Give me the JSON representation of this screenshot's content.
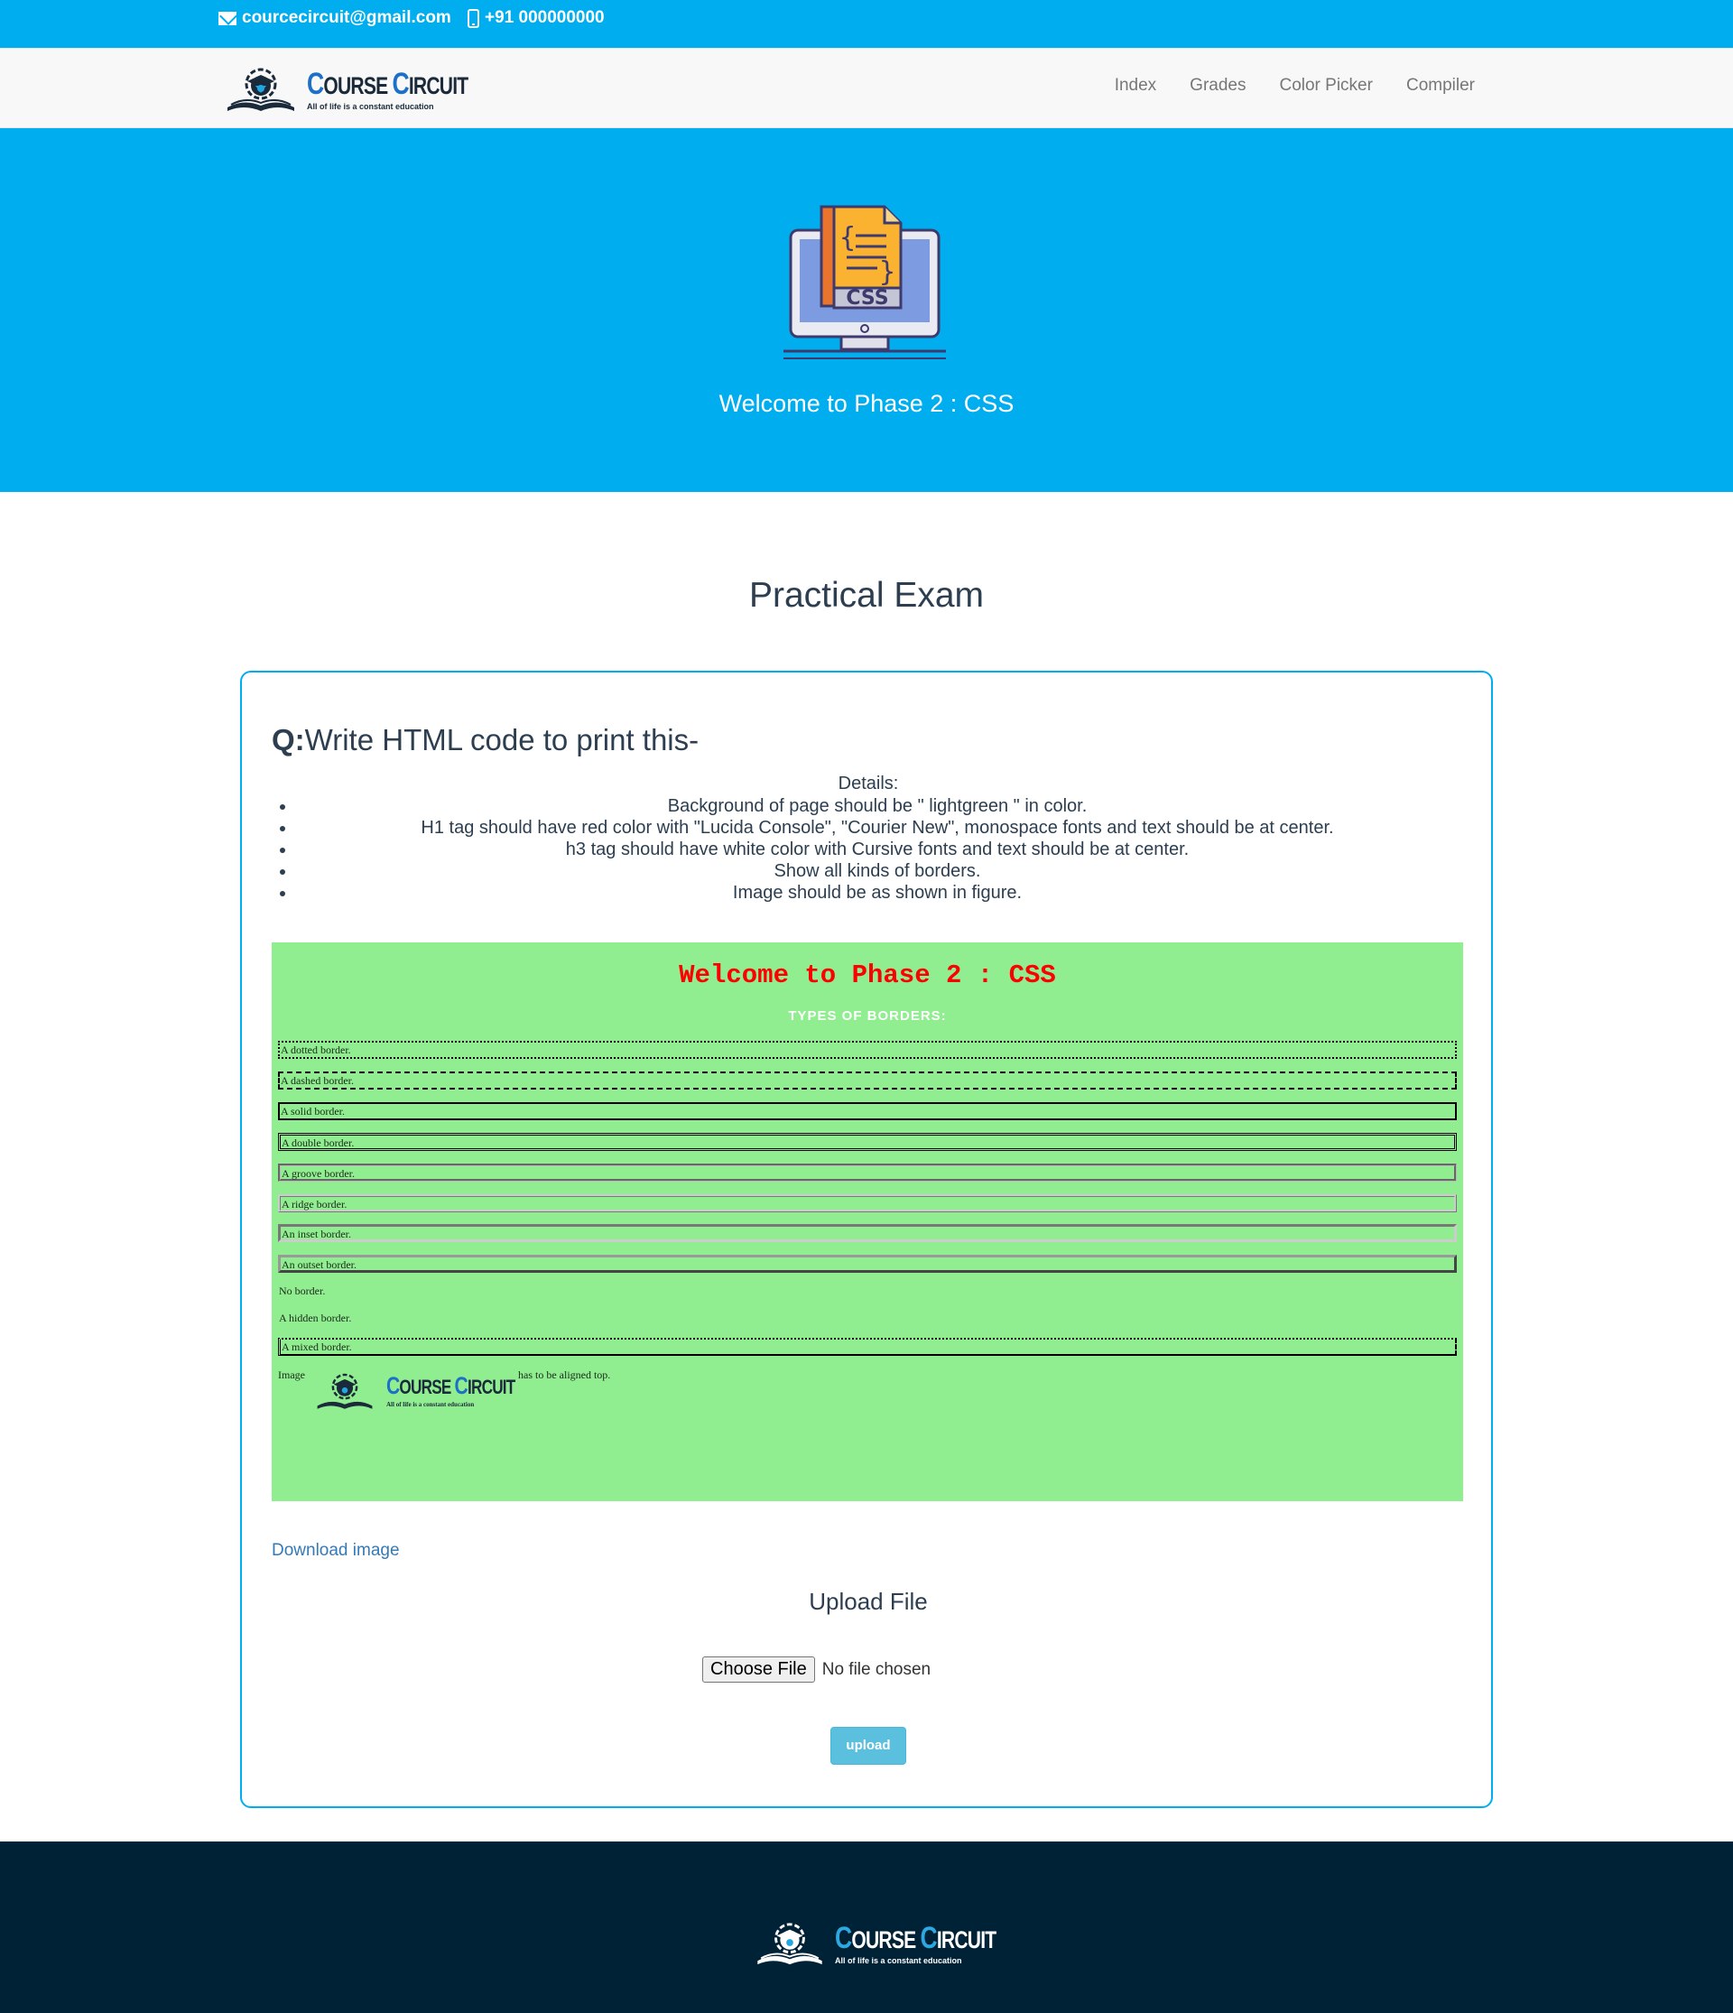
{
  "topbar": {
    "email": "courcecircuit@gmail.com",
    "phone": "+91 000000000",
    "bg_color": "#00aeef"
  },
  "brand": {
    "name_first": "C",
    "name_first_rest": "OURSE ",
    "name_second": "C",
    "name_second_rest": "IRCUIT",
    "tagline": "All of life is a constant education"
  },
  "nav": {
    "items": [
      {
        "label": "Index"
      },
      {
        "label": "Grades"
      },
      {
        "label": "Color Picker"
      },
      {
        "label": "Compiler"
      }
    ]
  },
  "hero": {
    "icon_label": "CSS",
    "title": "Welcome to Phase 2 : CSS"
  },
  "main": {
    "section_title": "Practical Exam",
    "question_prefix": "Q:",
    "question_text": "Write HTML code to print this-",
    "details_label": "Details:",
    "details": [
      "Background of page should be \" lightgreen \" in color.",
      "H1 tag should have red color with \"Lucida Console\", \"Courier New\", monospace fonts and text should be at center.",
      "h3 tag should have white color with Cursive fonts and text should be at center.",
      "Show all kinds of borders.",
      "Image should be as shown in figure."
    ],
    "preview": {
      "h1": "Welcome to Phase 2 : CSS",
      "h3": "TYPES OF BORDERS:",
      "borders": [
        "A dotted border.",
        "A dashed border.",
        "A solid border.",
        "A double border.",
        "A groove border.",
        "A ridge border.",
        "An inset border.",
        "An outset border.",
        "No border.",
        "A hidden border.",
        "A mixed border."
      ],
      "image_label": "Image",
      "image_after": "has to be aligned top.",
      "bg_color": "#90ee90"
    },
    "download_link": "Download image",
    "upload_title": "Upload File",
    "choose_file": "Choose File",
    "file_status": "No file chosen",
    "upload_button": "upload"
  }
}
